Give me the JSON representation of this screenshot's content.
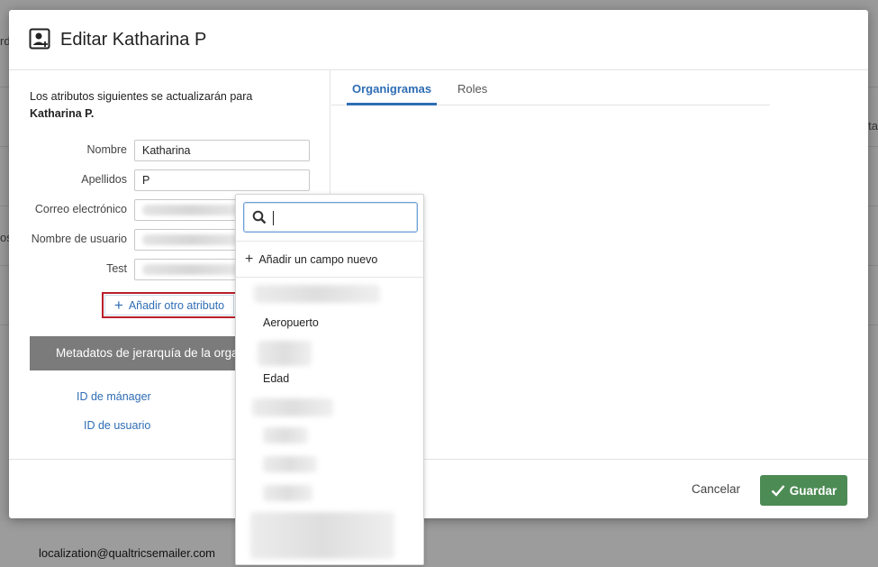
{
  "background": {
    "left_fragments": [
      "rd",
      "os"
    ],
    "right_fragments": [
      "ta"
    ],
    "footer_email": "localization@qualtricsemailer.com"
  },
  "modal": {
    "title": "Editar Katharina P",
    "intro_text": "Los atributos siguientes se actualizarán para",
    "intro_name": "Katharina P.",
    "fields": [
      {
        "label": "Nombre",
        "value": "Katharina"
      },
      {
        "label": "Apellidos",
        "value": "P"
      },
      {
        "label": "Correo electrónico",
        "value": ""
      },
      {
        "label": "Nombre de usuario",
        "value": ""
      },
      {
        "label": "Test",
        "value": ""
      }
    ],
    "add_attribute_label": "Añadir otro atributo",
    "metadata_title": "Metadatos de jerarquía de la organización",
    "links": {
      "manager_id": "ID de mánager",
      "user_id": "ID de usuario"
    },
    "tabs": [
      {
        "label": "Organigramas",
        "active": true
      },
      {
        "label": "Roles",
        "active": false
      }
    ],
    "footer": {
      "cancel_label": "Cancelar",
      "save_label": "Guardar"
    }
  },
  "dropdown": {
    "search_placeholder": "",
    "add_new_field_label": "Añadir un campo nuevo",
    "items": [
      "Aeropuerto",
      "Edad"
    ]
  },
  "colors": {
    "accent": "#2e6db4",
    "save": "#4d8b55",
    "highlight": "#b8202a",
    "metadata_bar": "#7b7b7b"
  }
}
